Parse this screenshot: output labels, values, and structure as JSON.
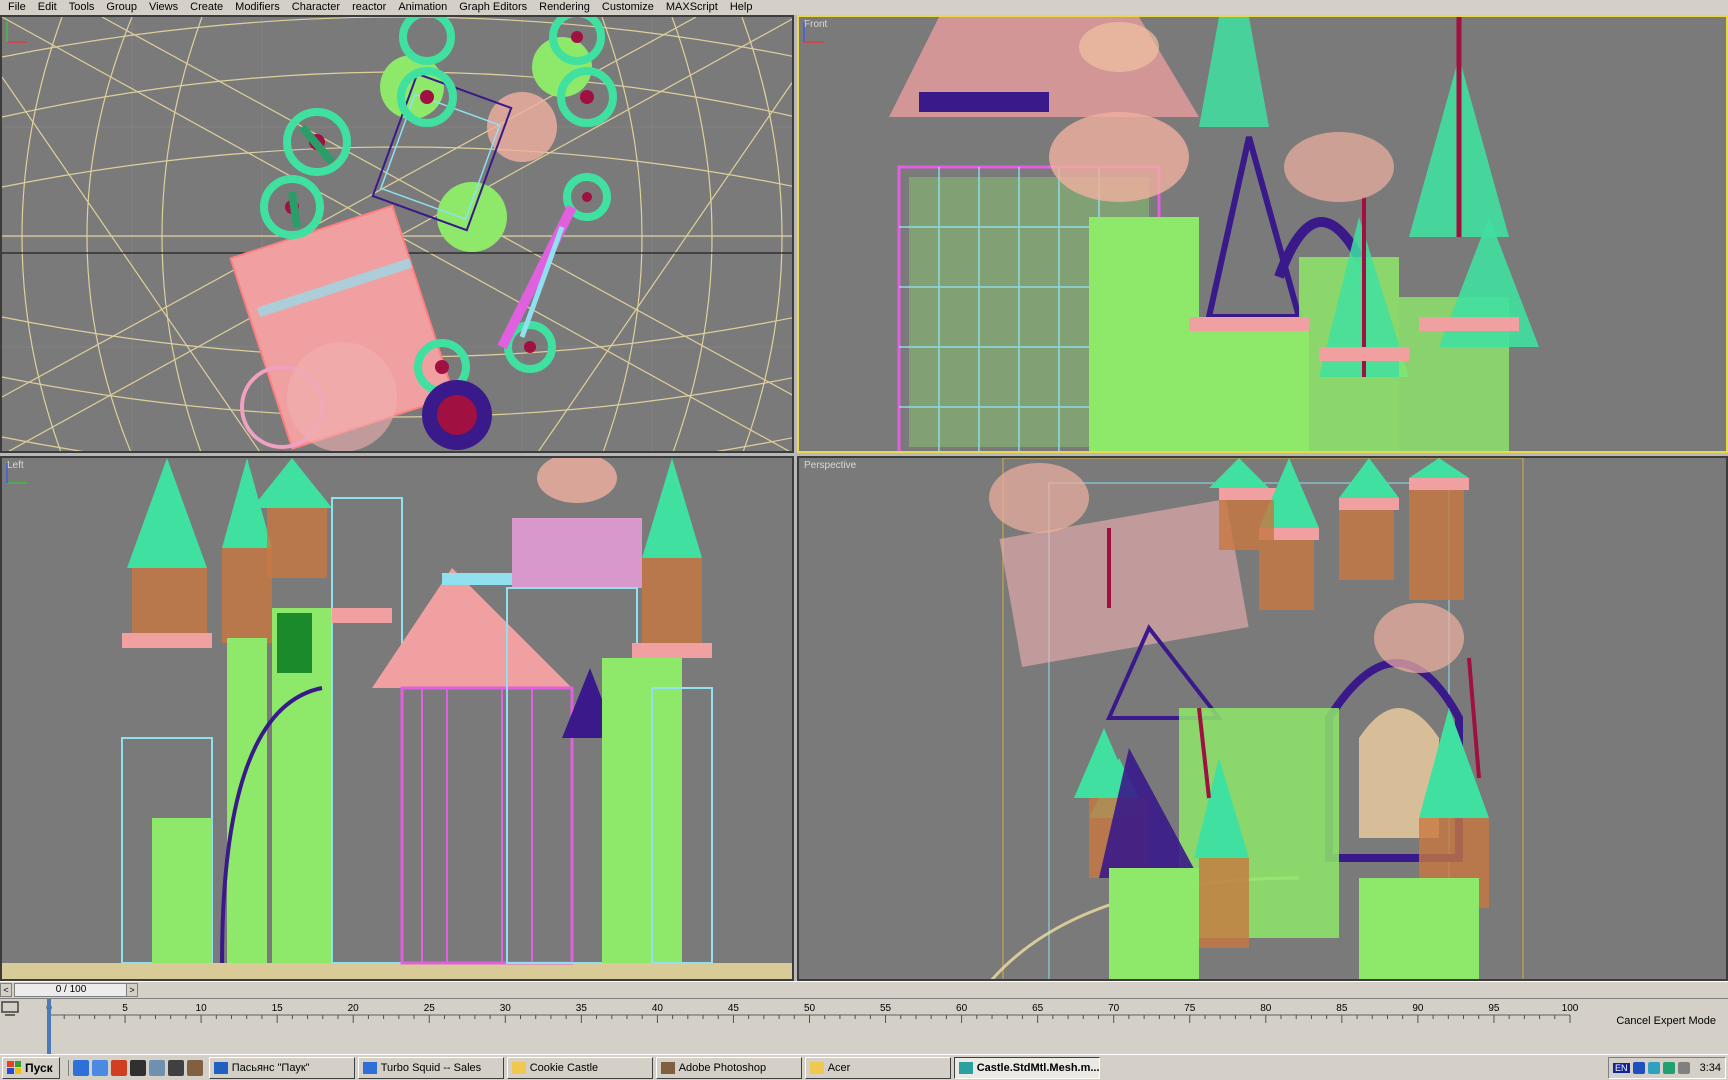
{
  "menubar": {
    "items": [
      "File",
      "Edit",
      "Tools",
      "Group",
      "Views",
      "Create",
      "Modifiers",
      "Character",
      "reactor",
      "Animation",
      "Graph Editors",
      "Rendering",
      "Customize",
      "MAXScript",
      "Help"
    ]
  },
  "viewports": {
    "top": {
      "label": ""
    },
    "front": {
      "label": "Front"
    },
    "left": {
      "label": "Left"
    },
    "perspective": {
      "label": "Perspective"
    }
  },
  "timeline": {
    "slider_text": "0 / 100",
    "current_frame": 0,
    "total_frames": 100,
    "ruler_ticks": [
      "0",
      "5",
      "10",
      "15",
      "20",
      "25",
      "30",
      "35",
      "40",
      "45",
      "50",
      "55",
      "60",
      "65",
      "70",
      "75",
      "80",
      "85",
      "90",
      "95",
      "100"
    ],
    "expert_mode_label": "Cancel Expert Mode",
    "prev_arrow": "<",
    "next_arrow": ">"
  },
  "taskbar": {
    "start_label": "Пуск",
    "tasks": [
      {
        "label": "Пасьянс \"Паук\"",
        "icon": "card-game-icon",
        "active": false
      },
      {
        "label": "Turbo Squid -- Sales",
        "icon": "browser-icon",
        "active": false
      },
      {
        "label": "Cookie Castle",
        "icon": "folder-icon",
        "active": false
      },
      {
        "label": "Adobe Photoshop",
        "icon": "photoshop-icon",
        "active": false
      },
      {
        "label": "Acer",
        "icon": "folder-icon",
        "active": false
      },
      {
        "label": "Castle.StdMtl.Mesh.m...",
        "icon": "3dsmax-icon",
        "active": true
      }
    ],
    "tray": {
      "language": "EN",
      "clock": "3:34"
    }
  },
  "colors": {
    "active_viewport_border": "#e8d84a",
    "viewport_bg": "#7a7a7a",
    "wire_green": "#8ee86a",
    "wire_pink": "#f0a0a0",
    "wire_teal": "#40e0a0",
    "wire_magenta": "#e060e0",
    "wire_cyan": "#90e0f0",
    "wire_purple": "#3a1a8a",
    "wire_crimson": "#a01040",
    "grid_yellow": "#f0e0a0"
  }
}
